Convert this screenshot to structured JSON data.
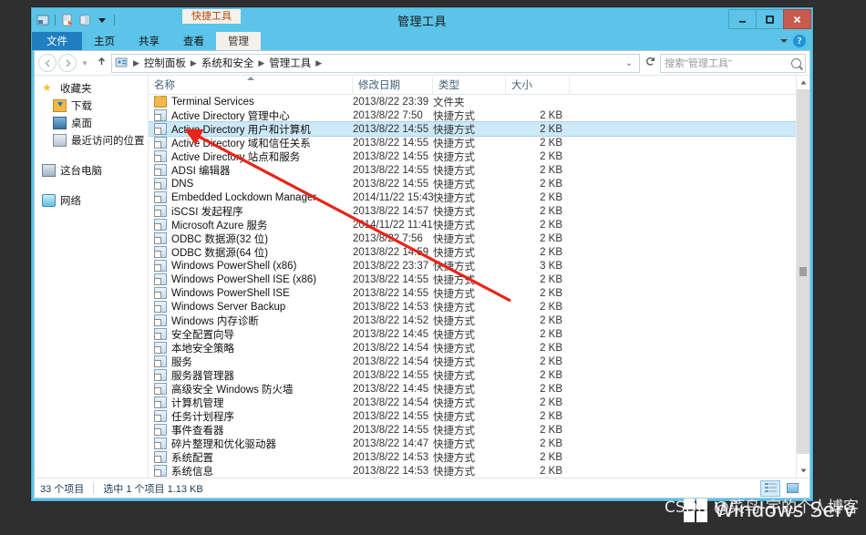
{
  "window": {
    "title": "管理工具",
    "contextual_tab": "快捷工具",
    "controls": {
      "minimize": "—",
      "maximize": "❐",
      "close": "✕"
    },
    "quick_access_icons": [
      "properties-icon",
      "new-folder-icon",
      "view-pane-icon",
      "customize-dropdown-icon"
    ]
  },
  "ribbon": {
    "tabs": [
      {
        "label": "文件",
        "state": "file"
      },
      {
        "label": "主页",
        "state": "normal"
      },
      {
        "label": "共享",
        "state": "normal"
      },
      {
        "label": "查看",
        "state": "normal"
      },
      {
        "label": "管理",
        "state": "contextual"
      }
    ],
    "collapse_label": "",
    "help_label": "?"
  },
  "address": {
    "back_label": "←",
    "forward_label": "→",
    "history_label": "⌄",
    "up_label": "↑",
    "crumbs": [
      "控制面板",
      "系统和安全",
      "管理工具"
    ],
    "separator": "▶",
    "dropdown_label": "⌄",
    "refresh_label": "⟳"
  },
  "search": {
    "placeholder": "搜索\"管理工具\"",
    "value": "搜索\"管理工具\"",
    "icon": "search-icon"
  },
  "navpane": {
    "groups": [
      {
        "label": "收藏夹",
        "icon": "star-icon",
        "children": [
          {
            "label": "下载",
            "icon": "downloads-folder-icon"
          },
          {
            "label": "桌面",
            "icon": "desktop-icon"
          },
          {
            "label": "最近访问的位置",
            "icon": "recent-places-icon"
          }
        ]
      },
      {
        "label": "这台电脑",
        "icon": "this-pc-icon",
        "children": []
      },
      {
        "label": "网络",
        "icon": "network-icon",
        "children": []
      }
    ]
  },
  "columns": [
    {
      "key": "name",
      "label": "名称",
      "sorted": true,
      "sort_dir": "asc"
    },
    {
      "key": "date",
      "label": "修改日期",
      "sorted": false
    },
    {
      "key": "type",
      "label": "类型",
      "sorted": false
    },
    {
      "key": "size",
      "label": "大小",
      "sorted": false
    }
  ],
  "rows": [
    {
      "name": "Terminal Services",
      "date": "2013/8/22 23:39",
      "type": "文件夹",
      "size": "",
      "icon": "folder-icon",
      "selected": false
    },
    {
      "name": "Active Directory 管理中心",
      "date": "2013/8/22 7:50",
      "type": "快捷方式",
      "size": "2 KB",
      "icon": "shortcut-icon",
      "selected": false
    },
    {
      "name": "Active Directory 用户和计算机",
      "date": "2013/8/22 14:55",
      "type": "快捷方式",
      "size": "2 KB",
      "icon": "shortcut-icon",
      "selected": true
    },
    {
      "name": "Active Directory 域和信任关系",
      "date": "2013/8/22 14:55",
      "type": "快捷方式",
      "size": "2 KB",
      "icon": "shortcut-icon",
      "selected": false
    },
    {
      "name": "Active Directory 站点和服务",
      "date": "2013/8/22 14:55",
      "type": "快捷方式",
      "size": "2 KB",
      "icon": "shortcut-icon",
      "selected": false
    },
    {
      "name": "ADSI 编辑器",
      "date": "2013/8/22 14:55",
      "type": "快捷方式",
      "size": "2 KB",
      "icon": "shortcut-icon",
      "selected": false
    },
    {
      "name": "DNS",
      "date": "2013/8/22 14:55",
      "type": "快捷方式",
      "size": "2 KB",
      "icon": "shortcut-icon",
      "selected": false
    },
    {
      "name": "Embedded Lockdown Manager",
      "date": "2014/11/22 15:43",
      "type": "快捷方式",
      "size": "2 KB",
      "icon": "shortcut-icon",
      "selected": false
    },
    {
      "name": "iSCSI 发起程序",
      "date": "2013/8/22 14:57",
      "type": "快捷方式",
      "size": "2 KB",
      "icon": "shortcut-icon",
      "selected": false
    },
    {
      "name": "Microsoft Azure 服务",
      "date": "2014/11/22 11:41",
      "type": "快捷方式",
      "size": "2 KB",
      "icon": "shortcut-icon",
      "selected": false
    },
    {
      "name": "ODBC 数据源(32 位)",
      "date": "2013/8/22 7:56",
      "type": "快捷方式",
      "size": "2 KB",
      "icon": "shortcut-icon",
      "selected": false
    },
    {
      "name": "ODBC 数据源(64 位)",
      "date": "2013/8/22 14:59",
      "type": "快捷方式",
      "size": "2 KB",
      "icon": "shortcut-icon",
      "selected": false
    },
    {
      "name": "Windows PowerShell (x86)",
      "date": "2013/8/22 23:37",
      "type": "快捷方式",
      "size": "3 KB",
      "icon": "shortcut-icon",
      "selected": false
    },
    {
      "name": "Windows PowerShell ISE (x86)",
      "date": "2013/8/22 14:55",
      "type": "快捷方式",
      "size": "2 KB",
      "icon": "shortcut-icon",
      "selected": false
    },
    {
      "name": "Windows PowerShell ISE",
      "date": "2013/8/22 14:55",
      "type": "快捷方式",
      "size": "2 KB",
      "icon": "shortcut-icon",
      "selected": false
    },
    {
      "name": "Windows Server Backup",
      "date": "2013/8/22 14:53",
      "type": "快捷方式",
      "size": "2 KB",
      "icon": "shortcut-icon",
      "selected": false
    },
    {
      "name": "Windows 内存诊断",
      "date": "2013/8/22 14:52",
      "type": "快捷方式",
      "size": "2 KB",
      "icon": "shortcut-icon",
      "selected": false
    },
    {
      "name": "安全配置向导",
      "date": "2013/8/22 14:45",
      "type": "快捷方式",
      "size": "2 KB",
      "icon": "shortcut-icon",
      "selected": false
    },
    {
      "name": "本地安全策略",
      "date": "2013/8/22 14:54",
      "type": "快捷方式",
      "size": "2 KB",
      "icon": "shortcut-icon",
      "selected": false
    },
    {
      "name": "服务",
      "date": "2013/8/22 14:54",
      "type": "快捷方式",
      "size": "2 KB",
      "icon": "shortcut-icon",
      "selected": false
    },
    {
      "name": "服务器管理器",
      "date": "2013/8/22 14:55",
      "type": "快捷方式",
      "size": "2 KB",
      "icon": "shortcut-icon",
      "selected": false
    },
    {
      "name": "高级安全 Windows 防火墙",
      "date": "2013/8/22 14:45",
      "type": "快捷方式",
      "size": "2 KB",
      "icon": "shortcut-icon",
      "selected": false
    },
    {
      "name": "计算机管理",
      "date": "2013/8/22 14:54",
      "type": "快捷方式",
      "size": "2 KB",
      "icon": "shortcut-icon",
      "selected": false
    },
    {
      "name": "任务计划程序",
      "date": "2013/8/22 14:55",
      "type": "快捷方式",
      "size": "2 KB",
      "icon": "shortcut-icon",
      "selected": false
    },
    {
      "name": "事件查看器",
      "date": "2013/8/22 14:55",
      "type": "快捷方式",
      "size": "2 KB",
      "icon": "shortcut-icon",
      "selected": false
    },
    {
      "name": "碎片整理和优化驱动器",
      "date": "2013/8/22 14:47",
      "type": "快捷方式",
      "size": "2 KB",
      "icon": "shortcut-icon",
      "selected": false
    },
    {
      "name": "系统配置",
      "date": "2013/8/22 14:53",
      "type": "快捷方式",
      "size": "2 KB",
      "icon": "shortcut-icon",
      "selected": false
    },
    {
      "name": "系统信息",
      "date": "2013/8/22 14:53",
      "type": "快捷方式",
      "size": "2 KB",
      "icon": "shortcut-icon",
      "selected": false
    }
  ],
  "statusbar": {
    "item_count": "33 个项目",
    "selection": "选中 1 个项目  1.13 KB",
    "view_details_label": "details-view",
    "view_thumbs_label": "thumbnails-view"
  },
  "scrollbar": {
    "up_label": "▲",
    "down_label": "▼"
  },
  "watermark": {
    "line1": "CSDN @菜鸟-宇的个人博客",
    "line2": "Windows Serv"
  },
  "colors": {
    "window_frame": "#5bc4e8",
    "file_tab": "#1f7fc0",
    "close_button": "#c85a4e",
    "selection": "#cde8f7",
    "annotation_arrow": "#e8241a",
    "contextual_tab_text": "#b24b0f"
  }
}
